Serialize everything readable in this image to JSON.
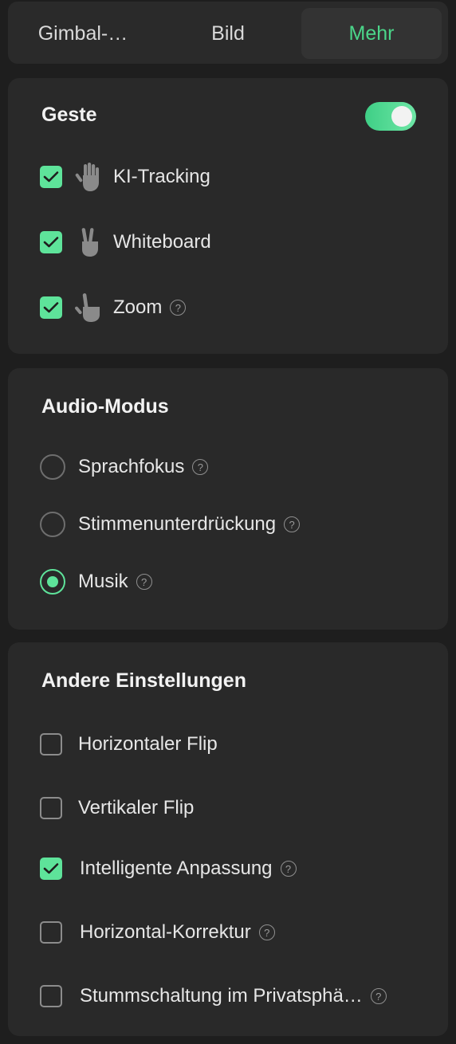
{
  "colors": {
    "accent": "#5ee39a",
    "card_bg": "#292929",
    "page_bg": "#1e1e1e"
  },
  "tabs": [
    {
      "label": "Gimbal-…",
      "active": false
    },
    {
      "label": "Bild",
      "active": false
    },
    {
      "label": "Mehr",
      "active": true
    }
  ],
  "gesture": {
    "title": "Geste",
    "enabled": true,
    "items": [
      {
        "label": "KI-Tracking",
        "checked": true,
        "icon": "open-hand-icon",
        "help": false
      },
      {
        "label": "Whiteboard",
        "checked": true,
        "icon": "peace-hand-icon",
        "help": false
      },
      {
        "label": "Zoom",
        "checked": true,
        "icon": "pointing-hand-icon",
        "help": true
      }
    ]
  },
  "audio": {
    "title": "Audio-Modus",
    "options": [
      {
        "label": "Sprachfokus",
        "selected": false,
        "help": true
      },
      {
        "label": "Stimmenunterdrückung",
        "selected": false,
        "help": true
      },
      {
        "label": "Musik",
        "selected": true,
        "help": true
      }
    ]
  },
  "other": {
    "title": "Andere Einstellungen",
    "items": [
      {
        "label": "Horizontaler Flip",
        "checked": false,
        "help": false
      },
      {
        "label": "Vertikaler Flip",
        "checked": false,
        "help": false
      },
      {
        "label": "Intelligente Anpassung",
        "checked": true,
        "help": true
      },
      {
        "label": "Horizontal-Korrektur",
        "checked": false,
        "help": true
      },
      {
        "label": "Stummschaltung im Privatsphä…",
        "checked": false,
        "help": true
      }
    ]
  },
  "help_glyph": "?"
}
